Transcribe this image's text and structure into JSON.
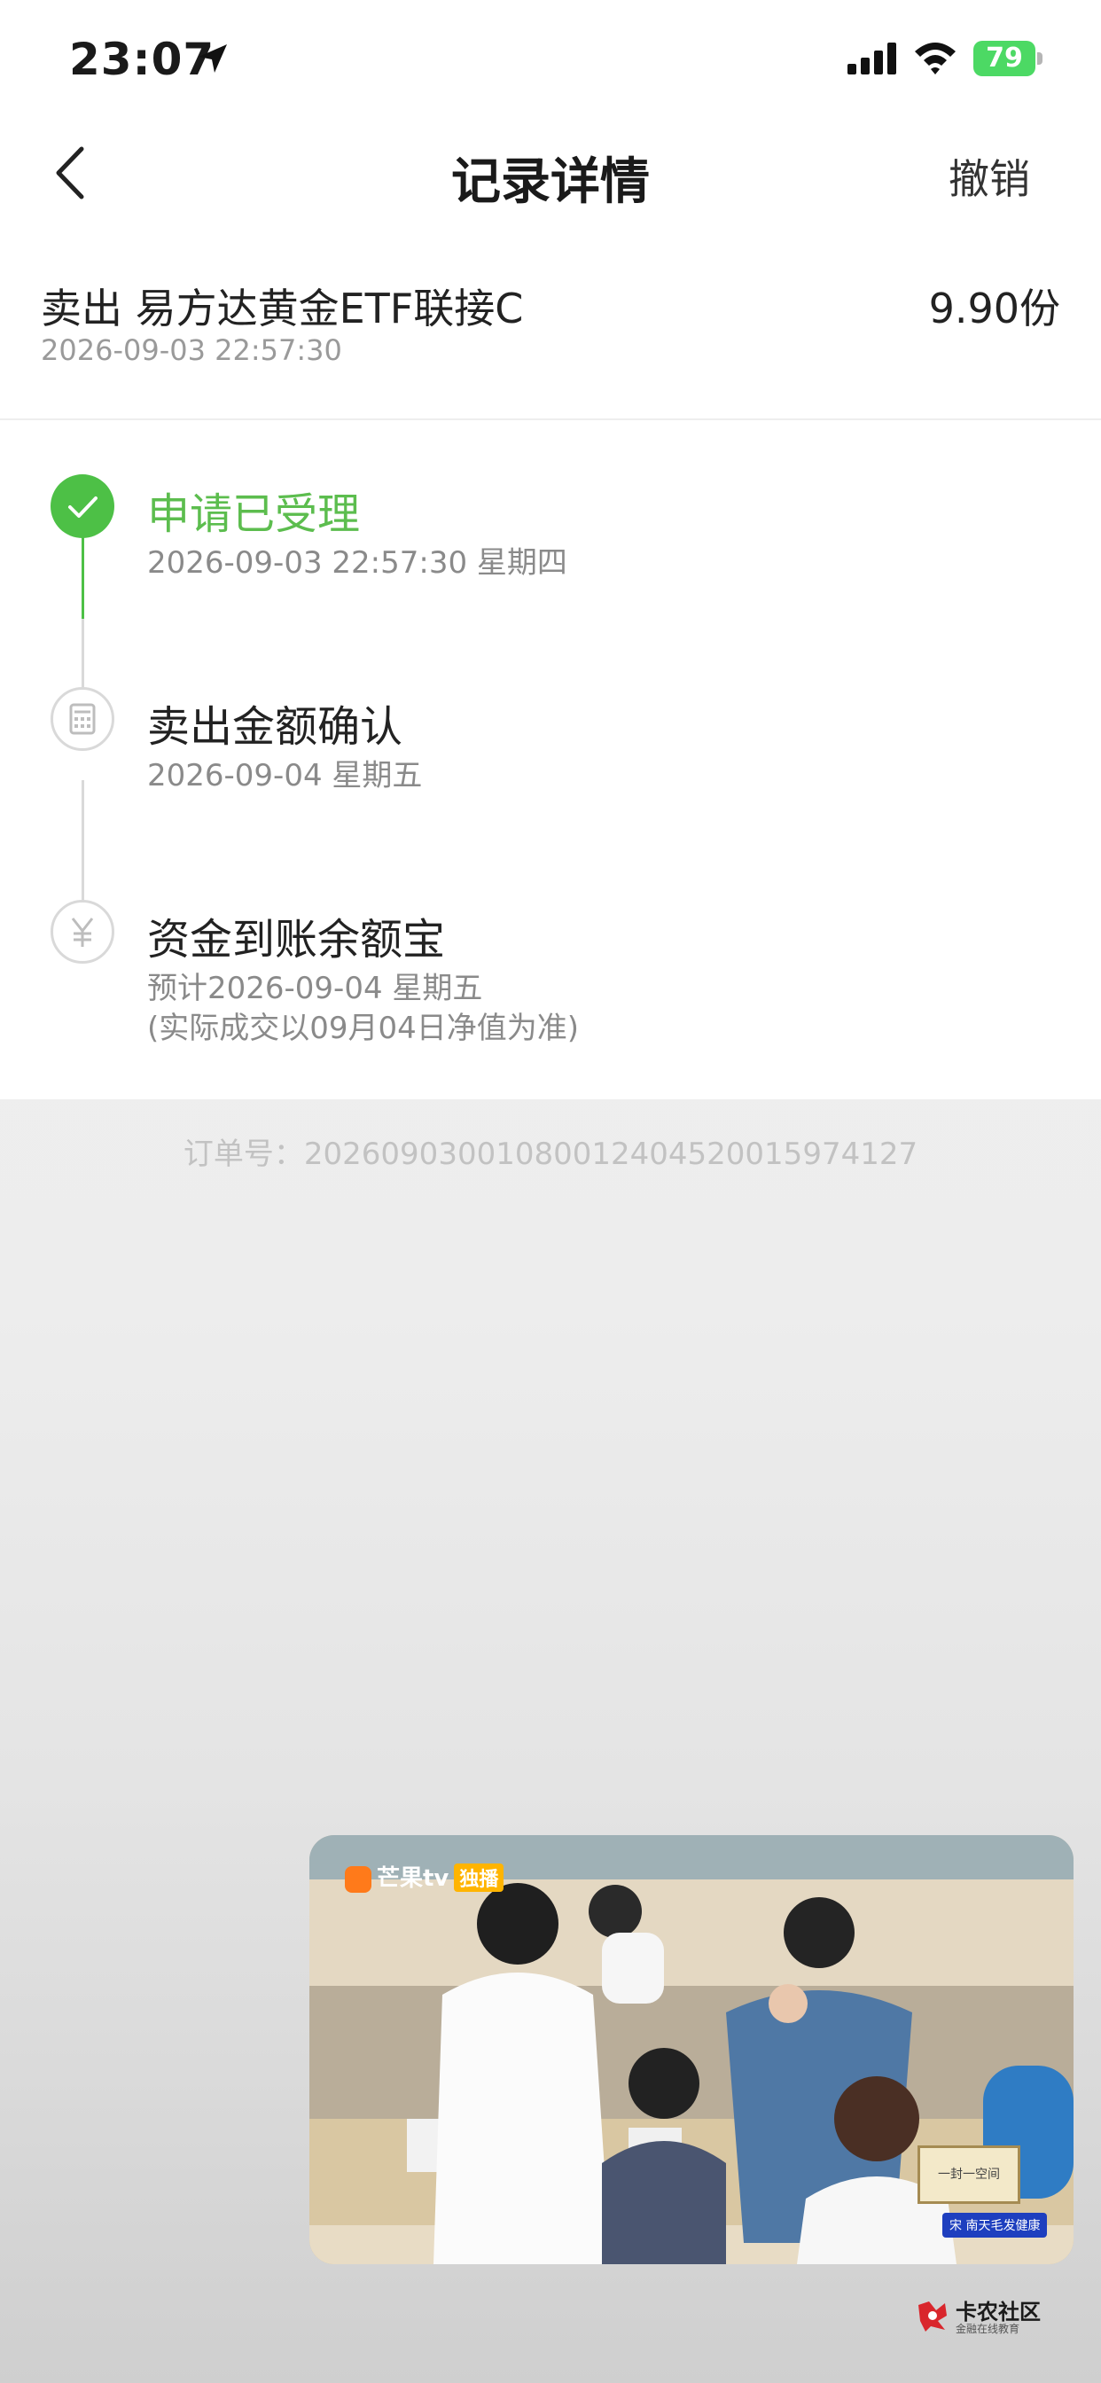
{
  "status_bar": {
    "time": "23:07",
    "battery": "79",
    "icons": [
      "location-arrow-icon",
      "cellular-signal-icon",
      "wifi-icon",
      "battery-charging-icon"
    ]
  },
  "nav": {
    "title": "记录详情",
    "action": "撤销",
    "back_icon": "chevron-left-icon"
  },
  "summary": {
    "label": "卖出 易方达黄金ETF联接C",
    "amount": "9.90份",
    "time": "2026-09-03 22:57:30"
  },
  "timeline": [
    {
      "title": "申请已受理",
      "sub": "2026-09-03 22:57:30 星期四",
      "sub2": "",
      "status": "done",
      "icon": "check-icon"
    },
    {
      "title": "卖出金额确认",
      "sub": "2026-09-04 星期五",
      "sub2": "",
      "status": "pending",
      "icon": "calculator-icon"
    },
    {
      "title": "资金到账余额宝",
      "sub": "预计2026-09-04 星期五",
      "sub2": "(实际成交以09月04日净值为准)",
      "status": "pending",
      "icon": "yen-icon"
    }
  ],
  "order": {
    "label": "订单号：",
    "value": "20260903001080012404520015974127"
  },
  "pip_video": {
    "logo": "芒果tv",
    "logo_tag": "独播",
    "board_text": "一封一空间",
    "sign_text": "宋 南天毛发健康"
  },
  "watermark": {
    "title": "卡农社区",
    "subtitle": "金融在线教育"
  },
  "colors": {
    "accent_green": "#4dc046",
    "active_text": "#5cbd4e",
    "muted_text": "#8a8a8a",
    "order_text": "#c2c2c2"
  }
}
